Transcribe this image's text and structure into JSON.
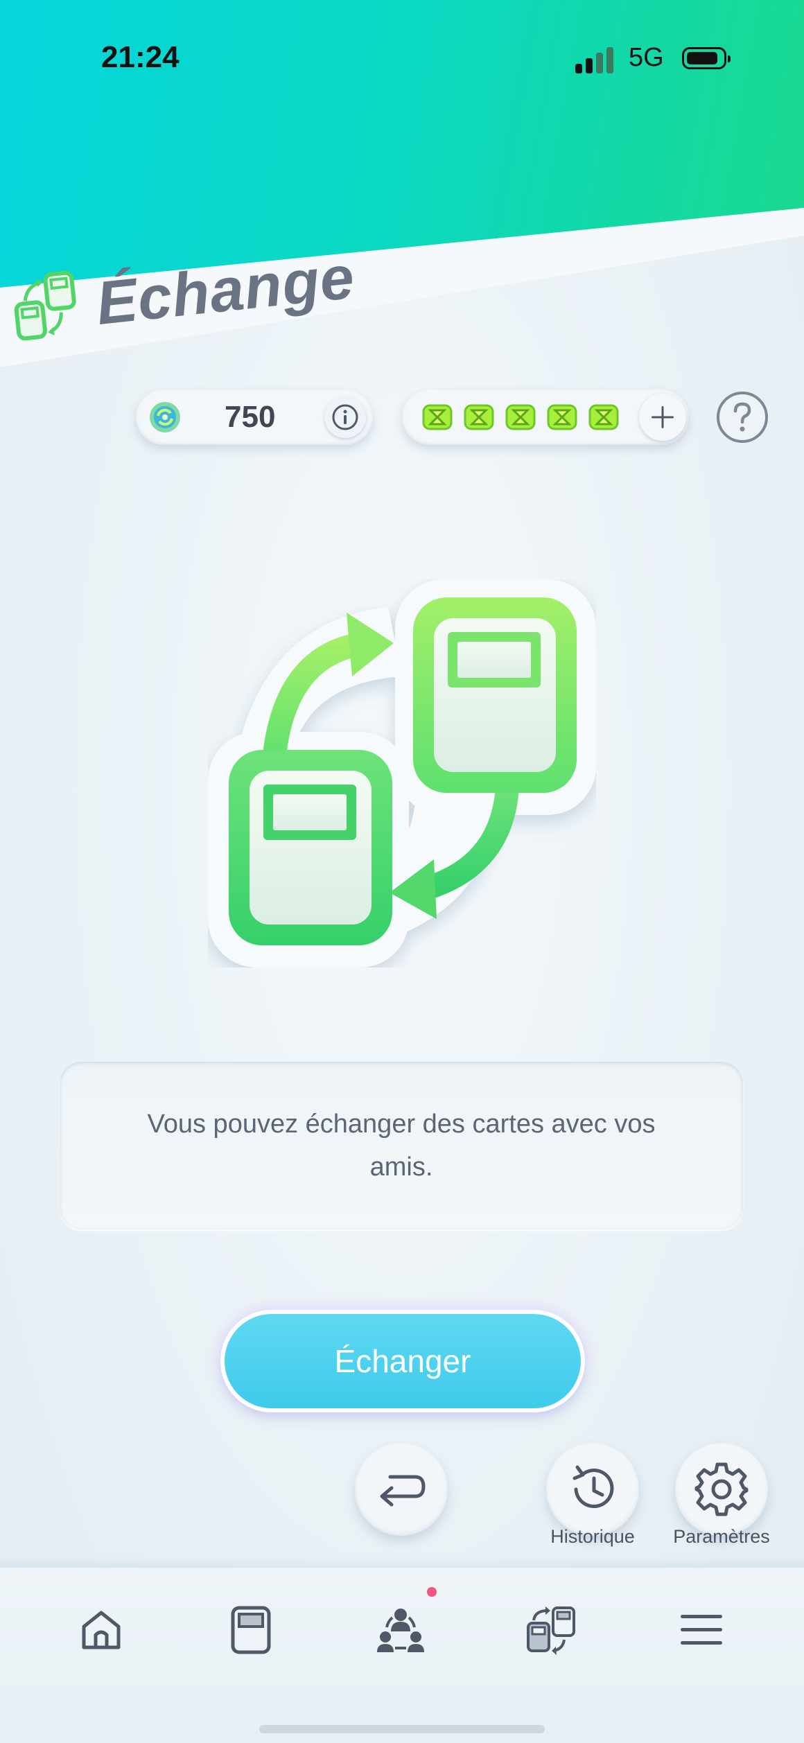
{
  "status_bar": {
    "time": "21:24",
    "network": "5G"
  },
  "header": {
    "title": "Échange",
    "icon": "trade-icon"
  },
  "currency": {
    "trade_points": {
      "icon": "trade-point-coin-icon",
      "value": "750",
      "info_icon": "info-icon"
    },
    "trade_stamina": {
      "icon": "hourglass-icon",
      "count": 5,
      "add_icon": "plus-icon"
    },
    "help_icon": "help-icon"
  },
  "emblem": {
    "icon": "card-exchange-icon"
  },
  "message": {
    "text": "Vous pouvez échanger des cartes avec vos amis."
  },
  "primary_action": {
    "label": "Échanger"
  },
  "actions": {
    "back_icon": "back-arrow-icon",
    "history_label": "Historique",
    "history_icon": "history-icon",
    "settings_label": "Paramètres",
    "settings_icon": "gear-icon"
  },
  "bottom_nav": {
    "items": [
      {
        "icon": "home-icon"
      },
      {
        "icon": "cards-icon"
      },
      {
        "icon": "social-icon",
        "notification": true
      },
      {
        "icon": "trade-icon"
      },
      {
        "icon": "menu-icon"
      }
    ]
  },
  "colors": {
    "header_gradient": [
      "#05d6dc",
      "#1ad98c"
    ],
    "accent_green": "#5fe06a",
    "button_blue": "#4ed0ee",
    "notification": "#f2557e"
  }
}
